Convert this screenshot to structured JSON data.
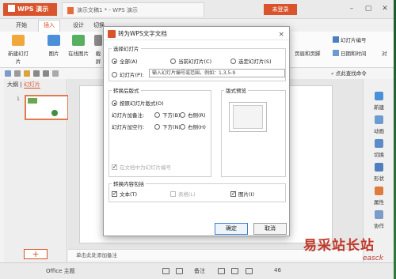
{
  "app": {
    "name": "WPS 演示",
    "doc_tab": "演示文稿1 * - WPS 演示",
    "login": "未登录"
  },
  "ribbon": {
    "tabs": [
      "开始",
      "插入",
      "设计",
      "切换"
    ],
    "active_tab": "插入",
    "items": [
      "新建幻灯片",
      "图片",
      "在线图片",
      "截屏"
    ],
    "right_items": [
      "幻灯片编号",
      "页眉和页脚",
      "日期和时间",
      "对"
    ],
    "search": "点此查找命令"
  },
  "left_panel": {
    "tab_outline": "大纲",
    "tab_slides": "幻灯片",
    "thumb_number": "1",
    "add_label": "+"
  },
  "notes": "单击此处添加备注",
  "right_panel": [
    "新建",
    "动画",
    "切换",
    "形状",
    "属性",
    "协作"
  ],
  "status": {
    "theme": "Office 主题",
    "notes": "备注",
    "zoom": "46"
  },
  "dialog": {
    "title": "转为WPS文字文档",
    "close": "×",
    "select_group": "选择幻灯片",
    "opt_all": "全部(A)",
    "opt_current": "当前幻灯片(C)",
    "opt_selected": "选定幻灯片(S)",
    "opt_slide": "幻灯片(P):",
    "range_placeholder": "输入幻灯片编号或范围，例如：1,3,5-9",
    "layout_group": "转换后版式",
    "opt_by_layout": "按原幻灯片版式(O)",
    "label_notes": "幻灯片加备注:",
    "opt_below": "下方(B)",
    "opt_right": "右侧(R)",
    "label_blank": "幻灯片加空行:",
    "opt_below2": "下方(N)",
    "opt_right2": "右侧(H)",
    "opt_show_num": "在文档中为幻灯片编号",
    "preview_group": "版式预览",
    "content_group": "转换内容包括",
    "chk_text": "文本(T)",
    "chk_table": "表格(L)",
    "chk_image": "图片(I)",
    "ok": "确定",
    "cancel": "取消"
  },
  "watermark": {
    "main": "易采站长站",
    "sub": "easck"
  },
  "colors": {
    "accent": "#d9532c",
    "ok_border": "#3c7fd1"
  }
}
